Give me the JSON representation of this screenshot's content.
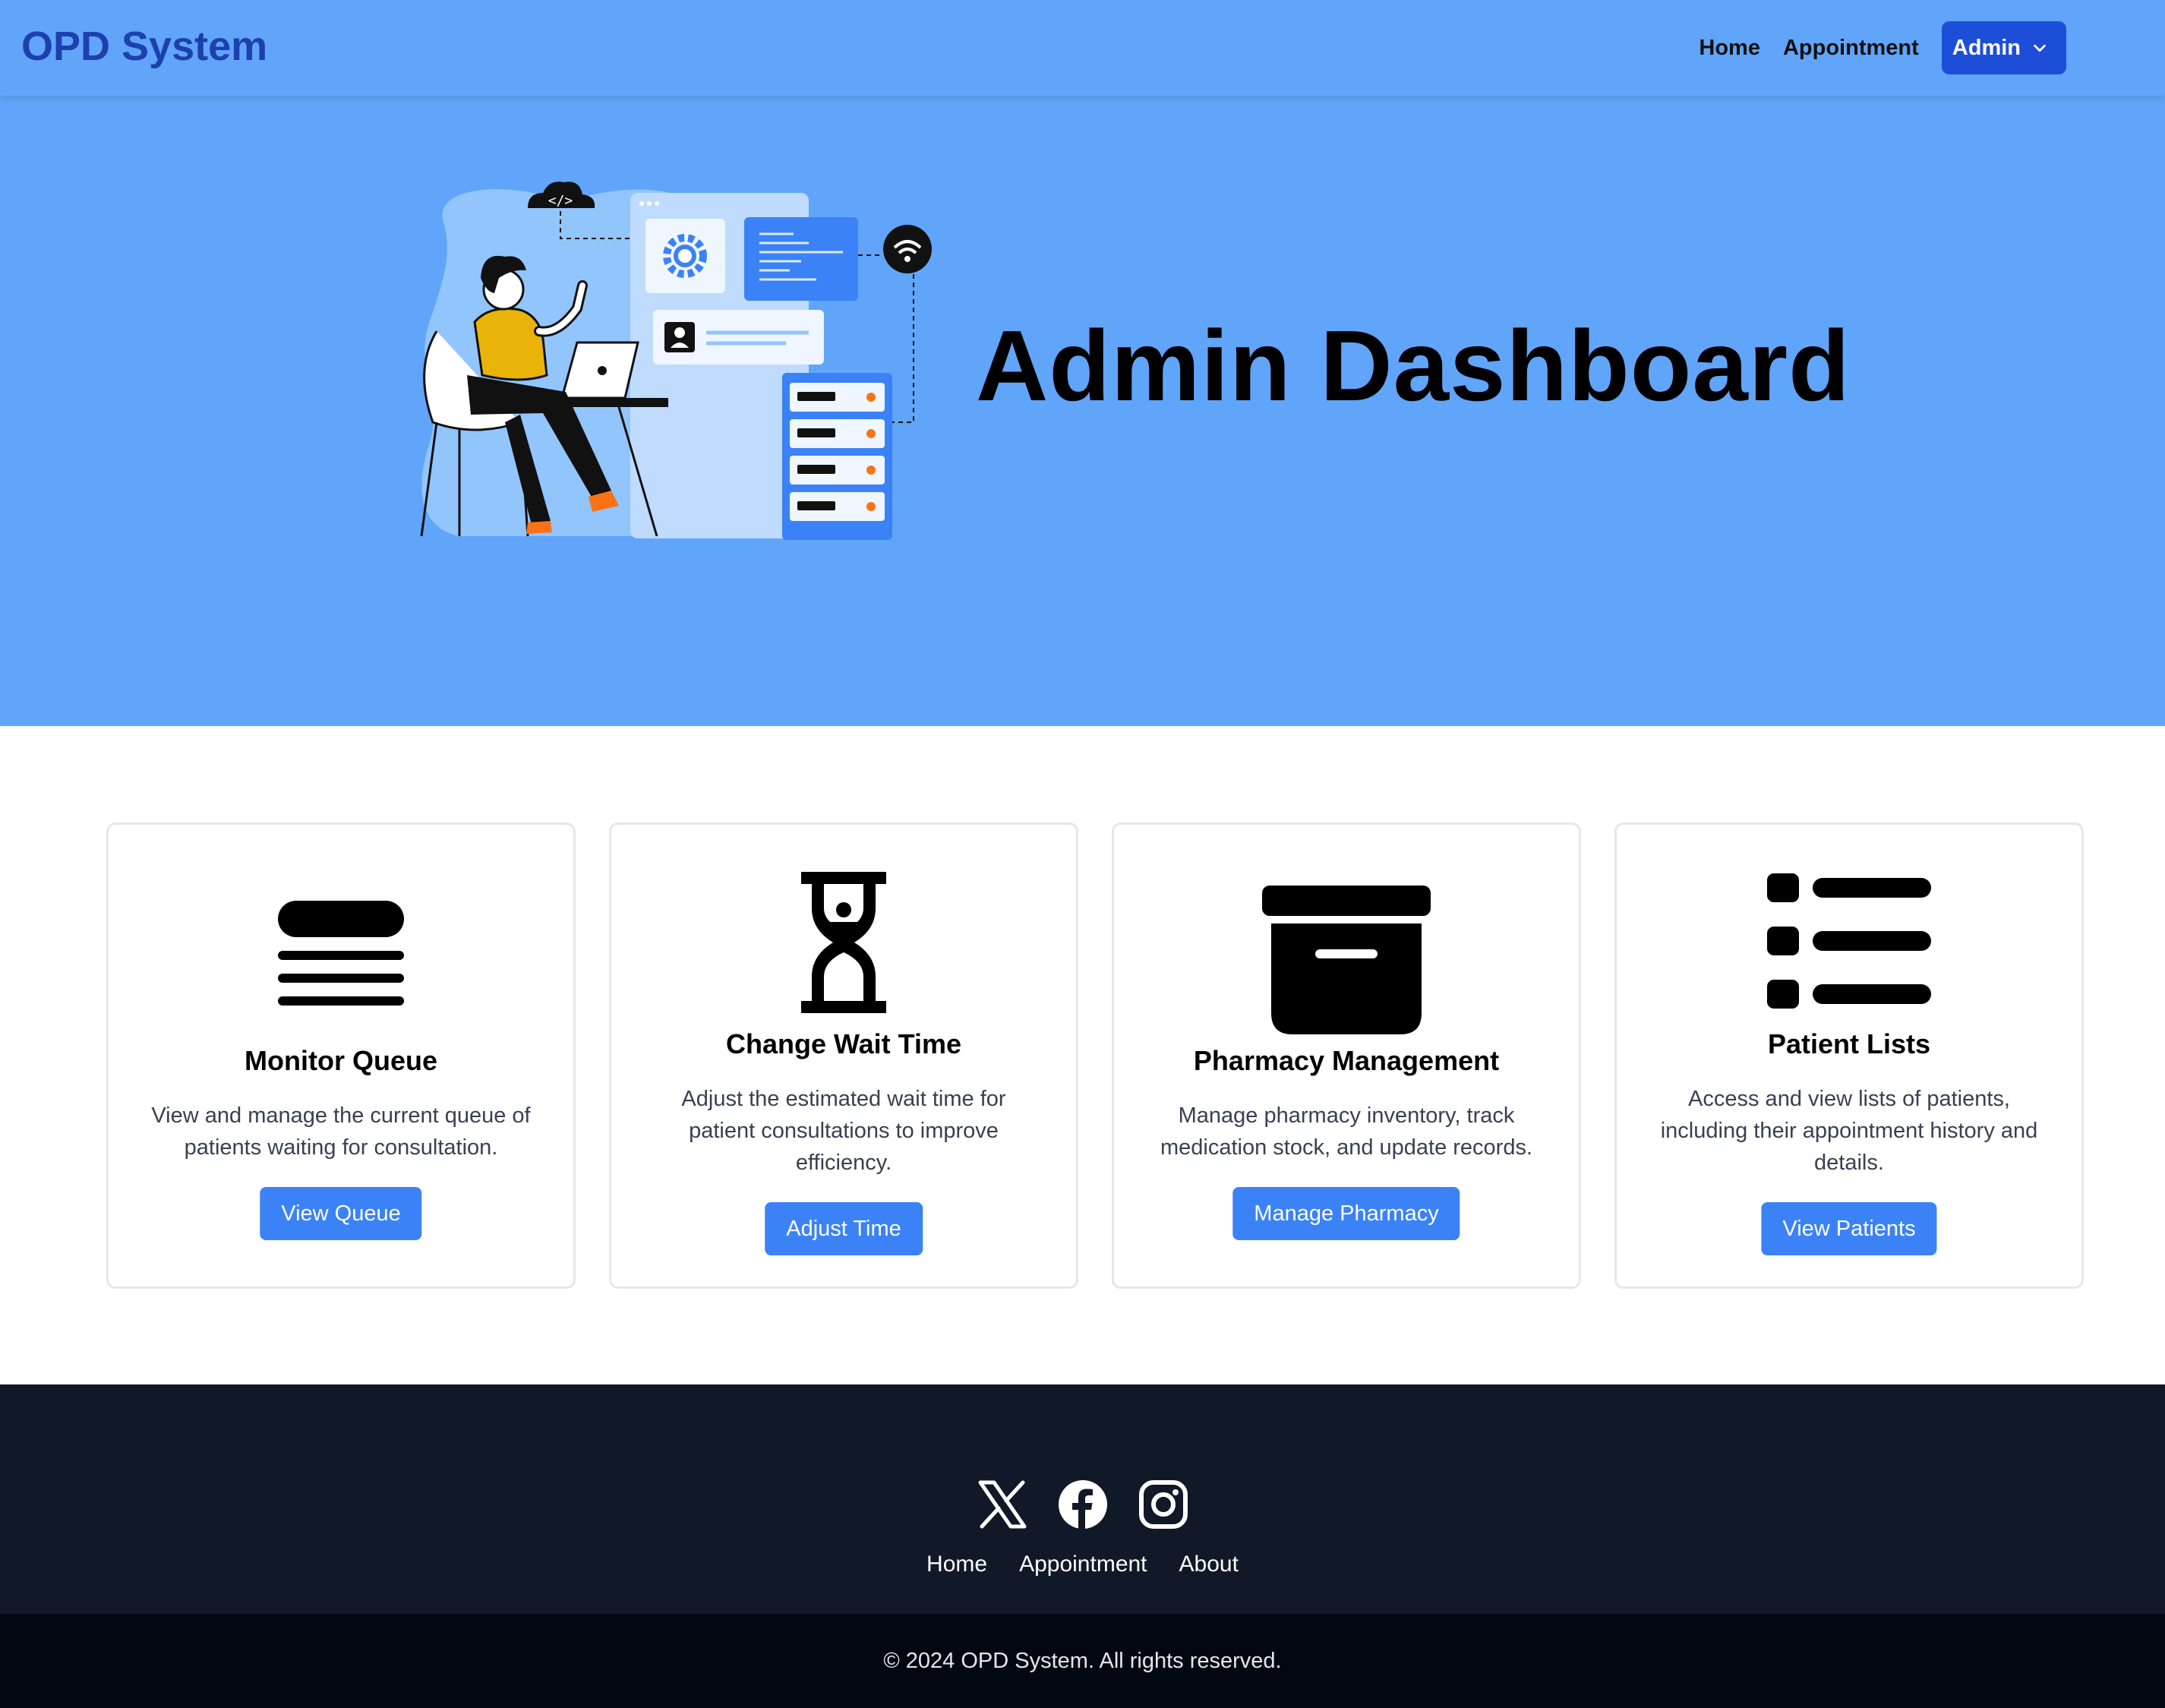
{
  "navbar": {
    "brand": "OPD System",
    "links": [
      "Home",
      "Appointment"
    ],
    "admin_label": "Admin"
  },
  "hero": {
    "title": "Admin Dashboard"
  },
  "cards": [
    {
      "title": "Monitor Queue",
      "description": "View and manage the current queue of patients waiting for consultation.",
      "button": "View Queue",
      "icon": "queue-icon"
    },
    {
      "title": "Change Wait Time",
      "description": "Adjust the estimated wait time for patient consultations to improve efficiency.",
      "button": "Adjust Time",
      "icon": "hourglass-icon"
    },
    {
      "title": "Pharmacy Management",
      "description": "Manage pharmacy inventory, track medication stock, and update records.",
      "button": "Manage Pharmacy",
      "icon": "archive-box-icon"
    },
    {
      "title": "Patient Lists",
      "description": "Access and view lists of patients, including their appointment history and details.",
      "button": "View Patients",
      "icon": "list-icon"
    }
  ],
  "footer": {
    "social_icons": [
      "x-icon",
      "facebook-icon",
      "instagram-icon"
    ],
    "links": [
      "Home",
      "Appointment",
      "About"
    ],
    "copyright": "© 2024 OPD System. All rights reserved."
  },
  "colors": {
    "primary": "#60a5fa",
    "admin_button": "#1d4ed8",
    "card_button": "#3b82f6",
    "footer": "#111827",
    "bottom_bar": "#030712"
  }
}
